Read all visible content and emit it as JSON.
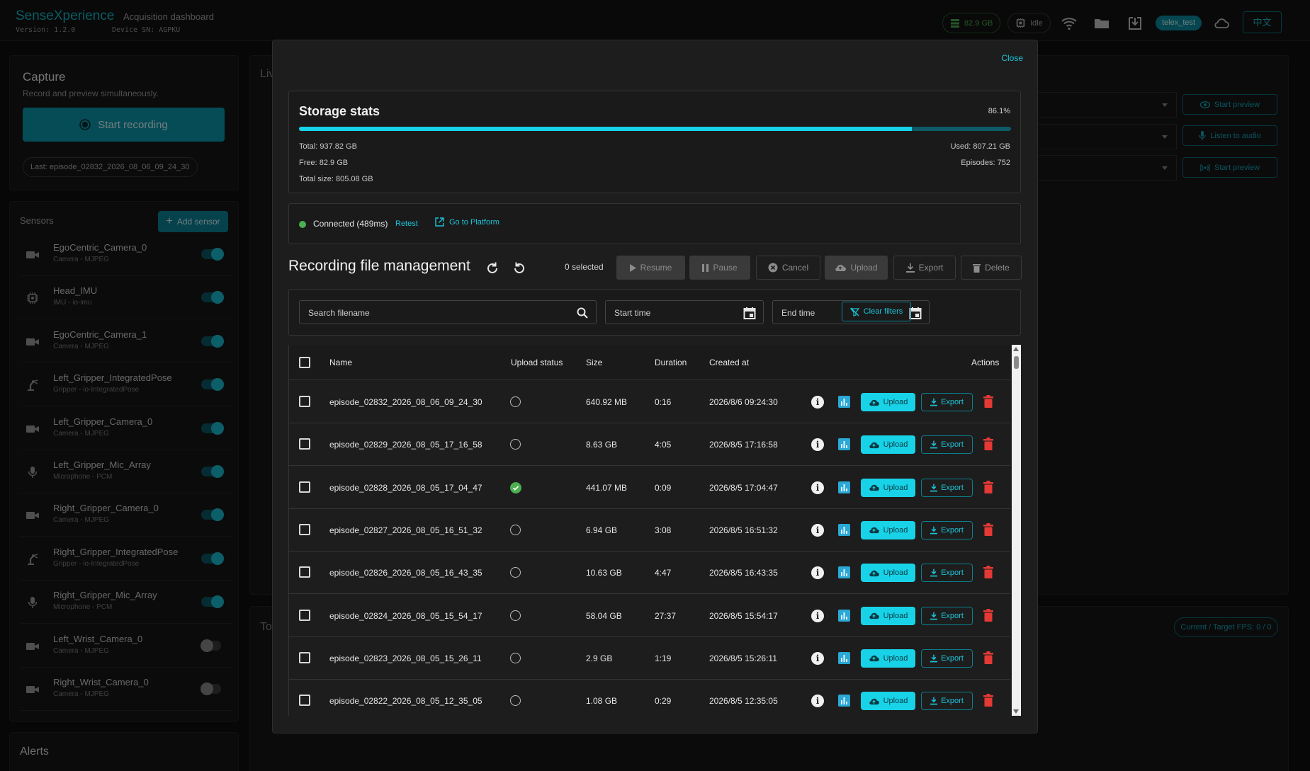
{
  "app": {
    "brand": "SenseXperience",
    "subtitle": "Acquisition dashboard",
    "version": "Version: 1.2.0",
    "device_sn": "Device SN: AGPKU",
    "storage_chip": "82.9 GB",
    "status_chip": "Idle",
    "user": "telex_test",
    "lang_button": "中文"
  },
  "capture": {
    "title": "Capture",
    "subtitle": "Record and preview simultaneously.",
    "record_button": "Start recording",
    "last_episode": "Last: episode_02832_2026_08_06_09_24_30"
  },
  "sensors": {
    "label": "Sensors",
    "add_button": "Add sensor",
    "items": [
      {
        "name": "EgoCentric_Camera_0",
        "type": "Camera - MJPEG",
        "icon": "camera-icon",
        "on": true
      },
      {
        "name": "Head_IMU",
        "type": "IMU - io-imu",
        "icon": "chip-icon",
        "on": true
      },
      {
        "name": "EgoCentric_Camera_1",
        "type": "Camera - MJPEG",
        "icon": "camera-icon",
        "on": true
      },
      {
        "name": "Left_Gripper_IntegratedPose",
        "type": "Gripper - io-IntegratedPose",
        "icon": "robot-arm-icon",
        "on": true
      },
      {
        "name": "Left_Gripper_Camera_0",
        "type": "Camera - MJPEG",
        "icon": "camera-icon",
        "on": true
      },
      {
        "name": "Left_Gripper_Mic_Array",
        "type": "Microphone - PCM",
        "icon": "microphone-icon",
        "on": true
      },
      {
        "name": "Right_Gripper_Camera_0",
        "type": "Camera - MJPEG",
        "icon": "camera-icon",
        "on": true
      },
      {
        "name": "Right_Gripper_IntegratedPose",
        "type": "Gripper - io-IntegratedPose",
        "icon": "robot-arm-icon",
        "on": true
      },
      {
        "name": "Right_Gripper_Mic_Array",
        "type": "Microphone - PCM",
        "icon": "microphone-icon",
        "on": true
      },
      {
        "name": "Left_Wrist_Camera_0",
        "type": "Camera - MJPEG",
        "icon": "camera-icon",
        "on": false
      },
      {
        "name": "Right_Wrist_Camera_0",
        "type": "Camera - MJPEG",
        "icon": "camera-icon",
        "on": false
      }
    ]
  },
  "alerts": {
    "title": "Alerts"
  },
  "live": {
    "title_partial": "Liv",
    "bottom_title_partial": "To",
    "start_preview": "Start preview",
    "listen_audio": "Listen to audio",
    "start_preview_2": "Start preview",
    "fps": "Current / Target FPS: 0 / 0"
  },
  "modal": {
    "close": "Close",
    "storage": {
      "title": "Storage stats",
      "percent": "86.1%",
      "used_fraction": 0.861,
      "total": "Total: 937.82 GB",
      "used": "Used: 807.21 GB",
      "free": "Free: 82.9 GB",
      "episodes": "Episodes: 752",
      "total_size": "Total size: 805.08 GB"
    },
    "connection": {
      "status": "Connected (489ms)",
      "retest": "Retest",
      "platform": "Go to Platform"
    },
    "rfm": {
      "title": "Recording file management",
      "selected": "0 selected",
      "resume": "Resume",
      "pause": "Pause",
      "cancel": "Cancel",
      "upload": "Upload",
      "export": "Export",
      "delete": "Delete"
    },
    "filters": {
      "search_placeholder": "Search filename",
      "start_placeholder": "Start time",
      "end_placeholder": "End time",
      "clear": "Clear filters"
    },
    "table": {
      "headers": {
        "name": "Name",
        "upload_status": "Upload status",
        "size": "Size",
        "duration": "Duration",
        "created": "Created at",
        "actions": "Actions"
      },
      "upload_label": "Upload",
      "export_label": "Export",
      "rows": [
        {
          "name": "episode_02832_2026_08_06_09_24_30",
          "uploaded": false,
          "size": "640.92 MB",
          "duration": "0:16",
          "created": "2026/8/6 09:24:30"
        },
        {
          "name": "episode_02829_2026_08_05_17_16_58",
          "uploaded": false,
          "size": "8.63 GB",
          "duration": "4:05",
          "created": "2026/8/5 17:16:58"
        },
        {
          "name": "episode_02828_2026_08_05_17_04_47",
          "uploaded": true,
          "size": "441.07 MB",
          "duration": "0:09",
          "created": "2026/8/5 17:04:47"
        },
        {
          "name": "episode_02827_2026_08_05_16_51_32",
          "uploaded": false,
          "size": "6.94 GB",
          "duration": "3:08",
          "created": "2026/8/5 16:51:32"
        },
        {
          "name": "episode_02826_2026_08_05_16_43_35",
          "uploaded": false,
          "size": "10.63 GB",
          "duration": "4:47",
          "created": "2026/8/5 16:43:35"
        },
        {
          "name": "episode_02824_2026_08_05_15_54_17",
          "uploaded": false,
          "size": "58.04 GB",
          "duration": "27:37",
          "created": "2026/8/5 15:54:17"
        },
        {
          "name": "episode_02823_2026_08_05_15_26_11",
          "uploaded": false,
          "size": "2.9 GB",
          "duration": "1:19",
          "created": "2026/8/5 15:26:11"
        },
        {
          "name": "episode_02822_2026_08_05_12_35_05",
          "uploaded": false,
          "size": "1.08 GB",
          "duration": "0:29",
          "created": "2026/8/5 12:35:05"
        }
      ]
    }
  },
  "colors": {
    "accent": "#17d2e6",
    "accent_dark": "#0a98ad",
    "success": "#4caf50",
    "danger": "#e53935"
  }
}
